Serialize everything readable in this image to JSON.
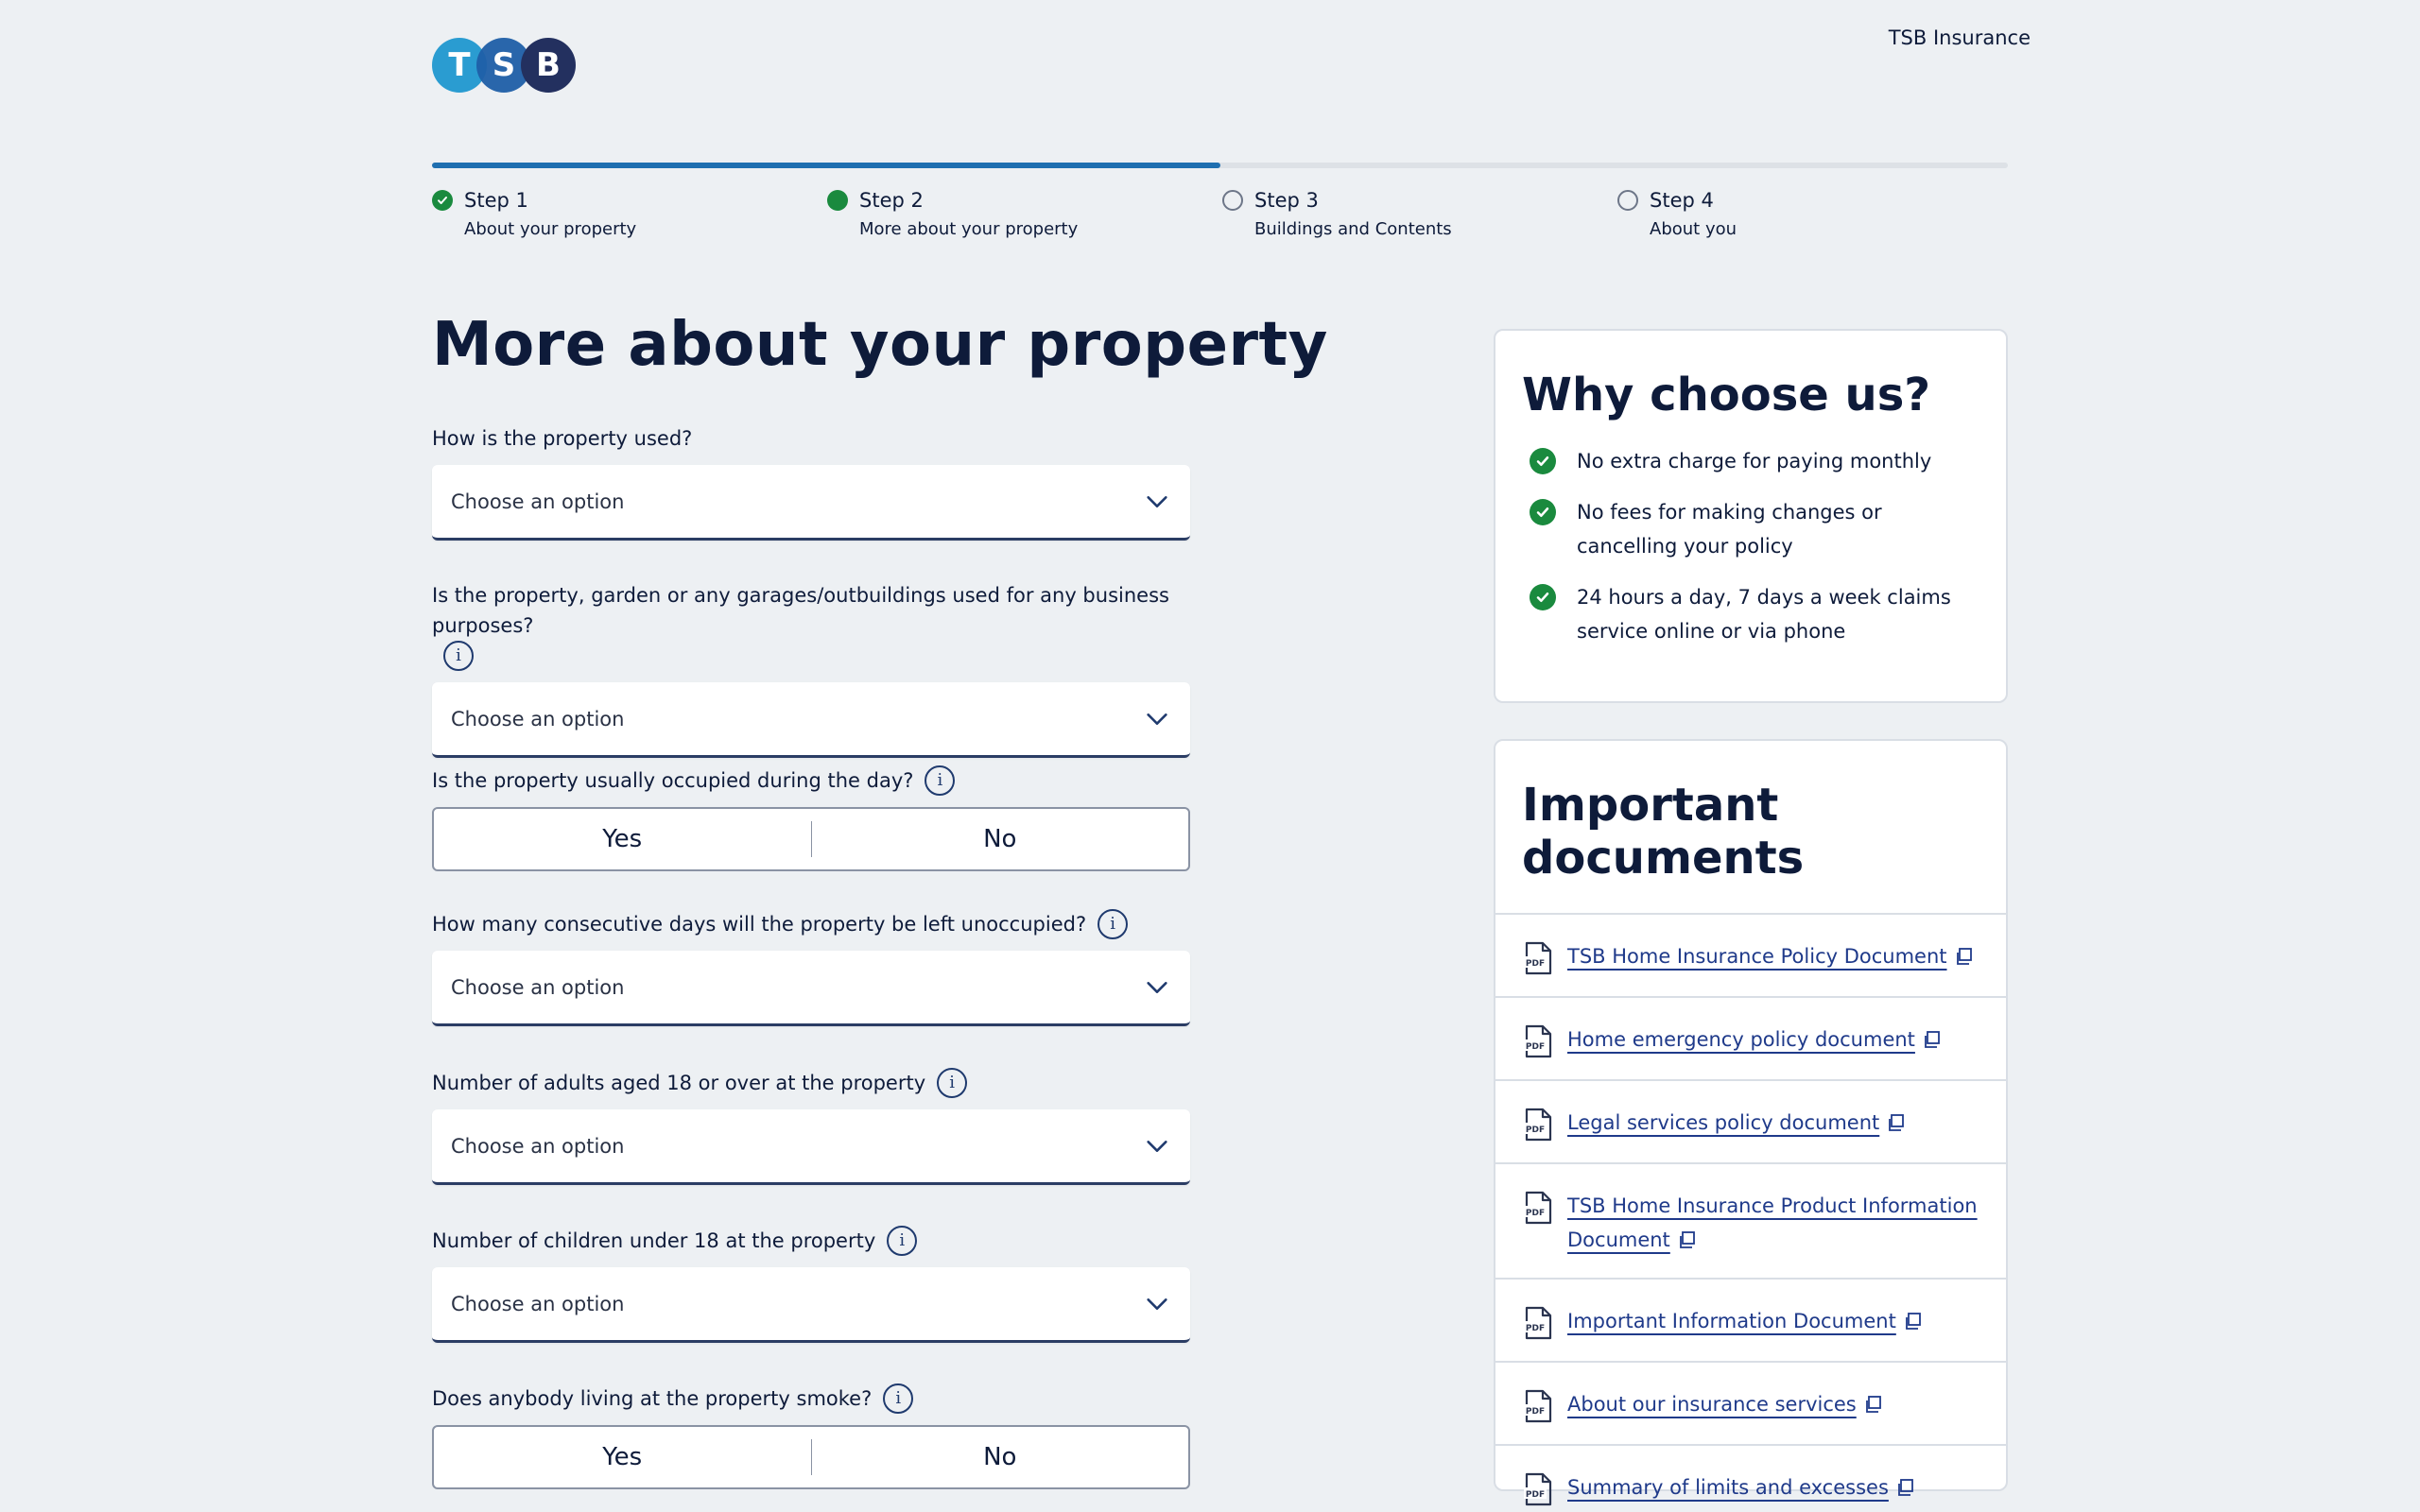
{
  "header": {
    "logo_letters": [
      "T",
      "S",
      "B"
    ],
    "brand_link": "TSB Insurance"
  },
  "progress": {
    "completed_fraction": 0.5
  },
  "steps": [
    {
      "title": "Step 1",
      "subtitle": "About your property",
      "state": "done"
    },
    {
      "title": "Step 2",
      "subtitle": "More about your property",
      "state": "current"
    },
    {
      "title": "Step 3",
      "subtitle": "Buildings and Contents",
      "state": "todo"
    },
    {
      "title": "Step 4",
      "subtitle": "About you",
      "state": "todo"
    }
  ],
  "main": {
    "title": "More about your property",
    "fields": [
      {
        "label": "How is the property used?",
        "type": "select",
        "value": "Choose an option",
        "info": false
      },
      {
        "label": "Is the property, garden or any garages/outbuildings used for any business purposes?",
        "type": "select",
        "value": "Choose an option",
        "info": true
      },
      {
        "label": "Is the property usually occupied during the day?",
        "type": "toggle",
        "options": [
          "Yes",
          "No"
        ],
        "info": true
      },
      {
        "label": "How many consecutive days will the property be left unoccupied?",
        "type": "select",
        "value": "Choose an option",
        "info": true
      },
      {
        "label": "Number of adults aged 18 or over at the property",
        "type": "select",
        "value": "Choose an option",
        "info": true
      },
      {
        "label": "Number of children under 18 at the property",
        "type": "select",
        "value": "Choose an option",
        "info": true
      },
      {
        "label": "Does anybody living at the property smoke?",
        "type": "toggle",
        "options": [
          "Yes",
          "No"
        ],
        "info": true
      }
    ],
    "info_glyph": "i"
  },
  "why": {
    "title": "Why choose us?",
    "items": [
      "No extra charge for paying monthly",
      "No fees for making changes or cancelling your policy",
      "24 hours a day, 7 days a week claims service online or via phone"
    ]
  },
  "docs": {
    "title": "Important documents",
    "items": [
      "TSB Home Insurance Policy Document",
      "Home emergency policy document",
      "Legal services policy document",
      "TSB Home Insurance Product Information Document",
      "Important Information Document",
      "About our insurance services",
      "Summary of limits and excesses"
    ]
  },
  "colors": {
    "accent": "#1f6fb0",
    "success": "#1a8a3e",
    "navy": "#0e1b3a",
    "link": "#1f3a8a",
    "background": "#edf0f3"
  },
  "icons": {
    "step_done": "check-circle-icon",
    "step_current": "filled-circle-icon",
    "step_todo": "empty-circle-icon",
    "info": "info-icon",
    "select": "chevron-down-icon",
    "why_item": "check-circle-icon",
    "doc": "pdf-icon",
    "doc_link": "external-link-icon"
  }
}
